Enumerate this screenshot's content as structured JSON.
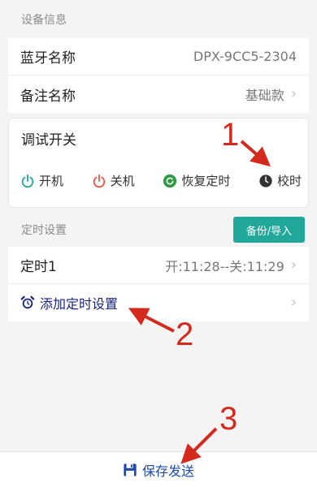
{
  "device_info": {
    "section_title": "设备信息",
    "bluetooth_label": "蓝牙名称",
    "bluetooth_value": "DPX-9CC5-2304",
    "remark_label": "备注名称",
    "remark_value": "基础款"
  },
  "debug_switch": {
    "title": "调试开关",
    "actions": {
      "power_on": "开机",
      "power_off": "关机",
      "restore_timer": "恢复定时",
      "calibrate": "校时"
    }
  },
  "timer_settings": {
    "section_title": "定时设置",
    "backup_label": "备份/导入",
    "timers": [
      {
        "label": "定时1",
        "value": "开:11:28--关:11:29"
      }
    ],
    "add_label": "添加定时设置"
  },
  "footer": {
    "save_label": "保存发送"
  },
  "annotations": {
    "n1": "1",
    "n2": "2",
    "n3": "3"
  },
  "colors": {
    "accent": "#21a89a",
    "power_on": "#21a89a",
    "power_off": "#e5553f",
    "restore": "#2e9a44",
    "calibrate": "#333333",
    "link": "#1a237e",
    "save": "#1e4aa8",
    "annotation": "#d42a1e"
  },
  "icons": {
    "power_on": "power-icon",
    "power_off": "power-icon",
    "restore": "refresh-icon",
    "calibrate": "clock-icon",
    "add": "alarm-clock-icon",
    "save": "floppy-disk-icon",
    "chevron": "chevron-right-icon"
  }
}
